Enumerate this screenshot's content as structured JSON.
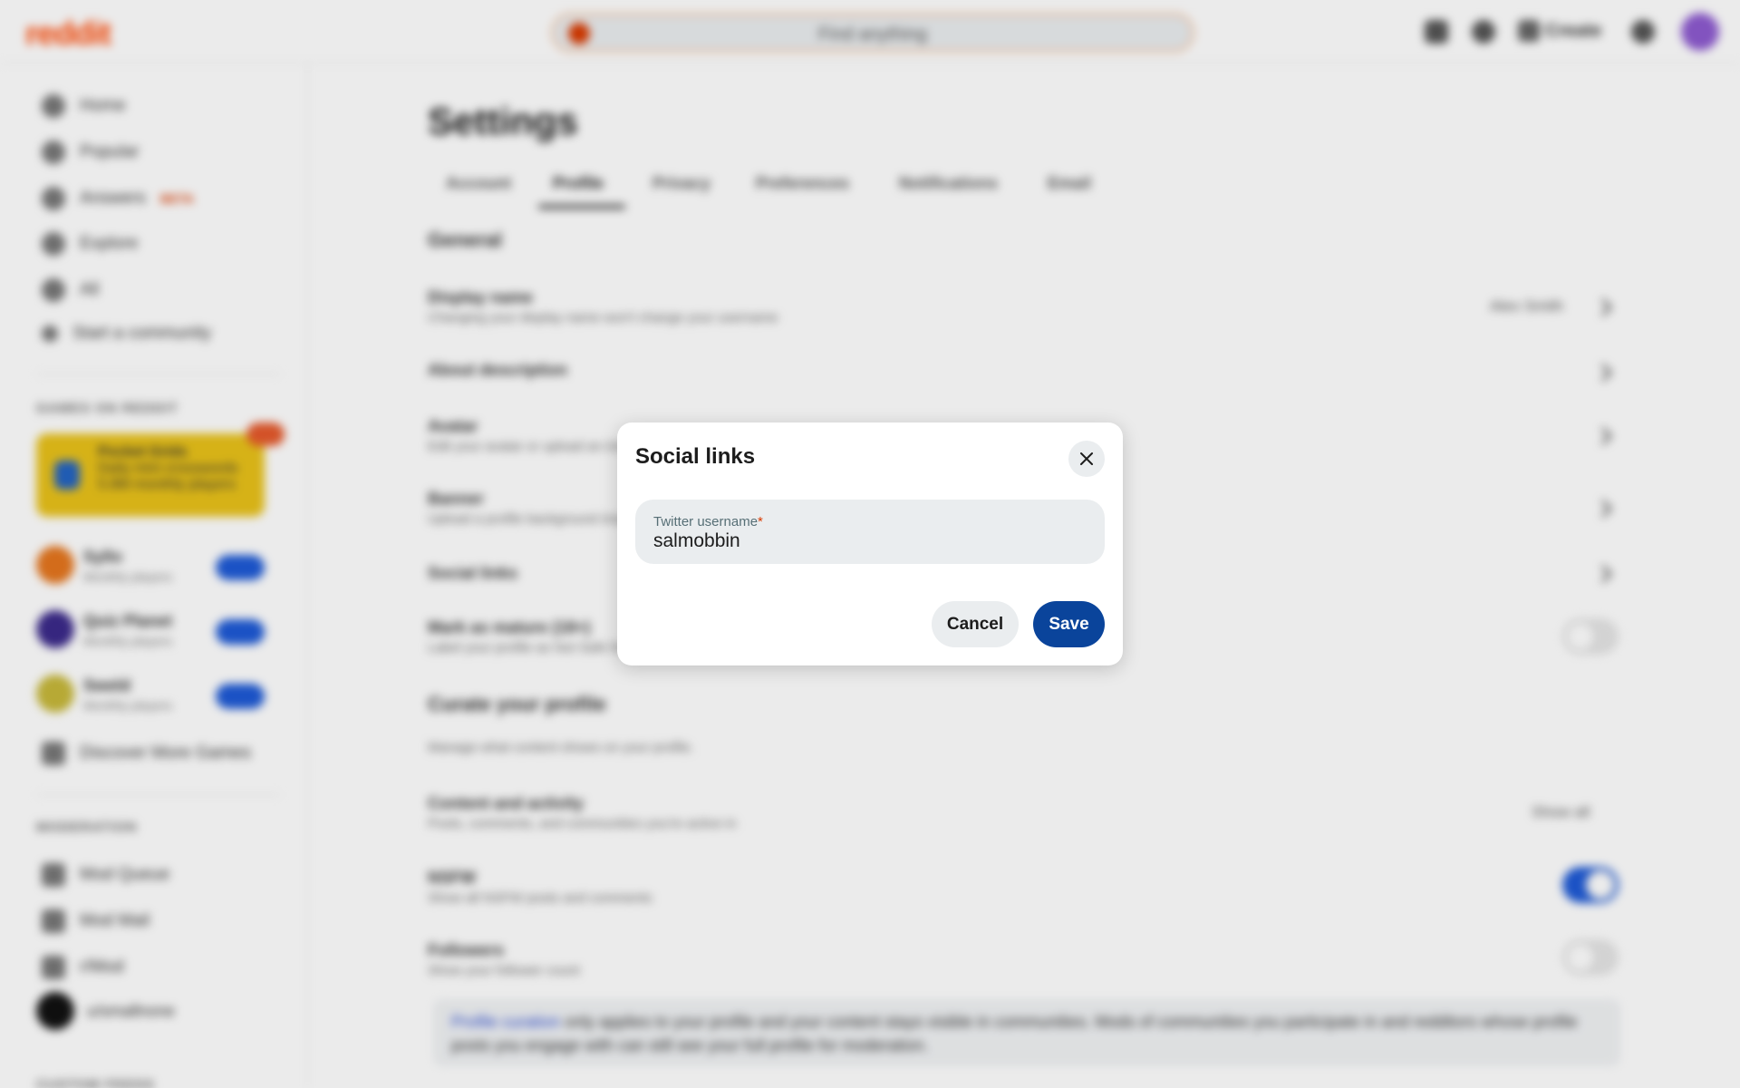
{
  "topbar": {
    "logo": "reddit",
    "search_placeholder": "Find anything",
    "create_label": "Create"
  },
  "sidebar": {
    "items": [
      {
        "label": "Home"
      },
      {
        "label": "Popular"
      },
      {
        "label": "Answers",
        "badge": "BETA"
      },
      {
        "label": "Explore"
      },
      {
        "label": "All"
      },
      {
        "label": "Start a community"
      }
    ],
    "games_header": "GAMES ON REDDIT",
    "promo": {
      "title": "Pocket Grids",
      "line1": "Daily mini crosswords",
      "line2": "5.8M monthly players"
    },
    "games": [
      {
        "name": "Syllo",
        "sub": "Monthly players",
        "color": "#e5761e"
      },
      {
        "name": "Quiz Planet",
        "sub": "Monthly players",
        "color": "#3b2a8a"
      },
      {
        "name": "Sweld",
        "sub": "Monthly players",
        "color": "#c7b83a"
      }
    ],
    "discover_label": "Discover More Games",
    "moderation_header": "MODERATION",
    "moderation_items": [
      {
        "label": "Mod Queue"
      },
      {
        "label": "Mod Mail"
      },
      {
        "label": "r/Mod"
      }
    ],
    "username": "u/smallnone",
    "custom_feeds_header": "CUSTOM FEEDS"
  },
  "main": {
    "title": "Settings",
    "tabs": [
      "Account",
      "Profile",
      "Privacy",
      "Preferences",
      "Notifications",
      "Email"
    ],
    "general_header": "General",
    "rows": [
      {
        "title": "Display name",
        "sub": "Changing your display name won't change your username",
        "value": "Alex Smith"
      },
      {
        "title": "About description",
        "sub": ""
      },
      {
        "title": "Avatar",
        "sub": "Edit your avatar or upload an image"
      },
      {
        "title": "Banner",
        "sub": "Upload a profile background image"
      },
      {
        "title": "Social links",
        "sub": ""
      },
      {
        "title": "Mark as mature (18+)",
        "sub": "Label your profile as Not Safe for Work (NSFW)"
      }
    ],
    "curate_header": "Curate your profile",
    "curate_sub": "Manage what content shows on your profile.",
    "content_title": "Content and activity",
    "content_sub": "Posts, comments, and communities you're active in",
    "content_value": "Show all",
    "nsfw_title": "NSFW",
    "nsfw_sub": "Show all NSFW posts and comments",
    "followers_title": "Followers",
    "followers_sub": "Show your follower count",
    "notice_link": "Profile curation",
    "notice_text": " only applies to your profile and your content stays visible in communities. Mods of communities you participate in and redditors whose profile posts you engage with can still see your full profile for moderation."
  },
  "modal": {
    "title": "Social links",
    "field_label": "Twitter username",
    "field_required": "*",
    "field_value": "salmobbin",
    "cancel_label": "Cancel",
    "save_label": "Save"
  }
}
